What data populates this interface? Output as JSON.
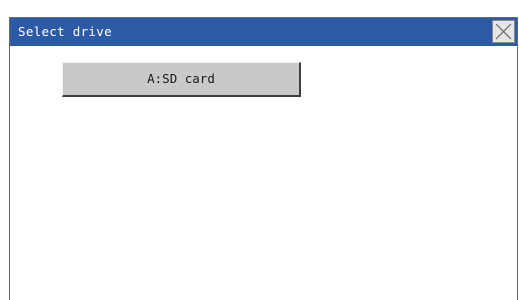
{
  "dialog": {
    "title": "Select drive",
    "close_icon": "close-x-icon"
  },
  "drives": [
    {
      "label": "A:SD card"
    }
  ],
  "colors": {
    "titlebar": "#2d5aa6",
    "button_face": "#c9c9c9"
  }
}
